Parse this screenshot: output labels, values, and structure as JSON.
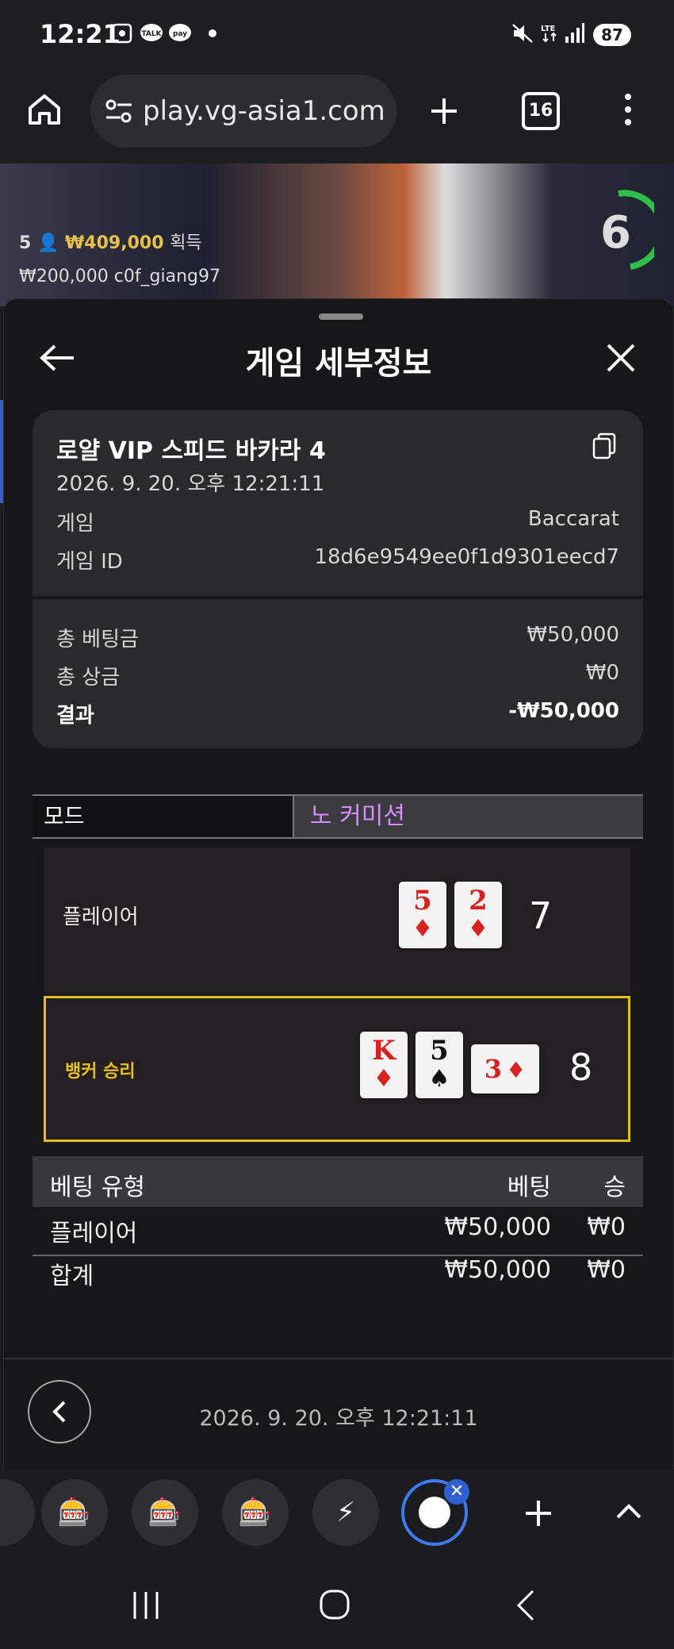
{
  "status_bar": {
    "time": "12:21",
    "battery": "87"
  },
  "browser": {
    "url": "play.vg-asia1.com",
    "tab_count": "16"
  },
  "video": {
    "players": "5",
    "won_amount": "₩409,000",
    "won_label": "획득",
    "bet_line": "₩200,000  c0f_giang97",
    "timer": "6"
  },
  "sheet": {
    "title": "게임 세부정보",
    "game_name": "로얄 VIP 스피드 바카라 4",
    "datetime": "2026. 9. 20. 오후 12:21:11",
    "game_label": "게임",
    "game_value": "Baccarat",
    "game_id_label": "게임 ID",
    "game_id_value": "18d6e9549ee0f1d9301eecd7",
    "total_bet_label": "총 베팅금",
    "total_bet_value": "₩50,000",
    "total_prize_label": "총 상금",
    "total_prize_value": "₩0",
    "result_label": "결과",
    "result_value": "-₩50,000",
    "mode_label": "모드",
    "mode_value": "노 커미션",
    "player": {
      "label": "플레이어",
      "score": "7",
      "cards": [
        {
          "rank": "5",
          "suit": "♦"
        },
        {
          "rank": "2",
          "suit": "♦"
        }
      ]
    },
    "banker": {
      "label": "뱅커 승리",
      "score": "8",
      "cards": [
        {
          "rank": "K",
          "suit": "♦"
        },
        {
          "rank": "5",
          "suit": "♠"
        },
        {
          "rank": "3",
          "suit": "♦"
        }
      ]
    },
    "bet_table": {
      "headers": [
        "베팅 유형",
        "베팅",
        "승"
      ],
      "rows": [
        [
          "플레이어",
          "₩50,000",
          "₩0"
        ]
      ],
      "total": [
        "합계",
        "₩50,000",
        "₩0"
      ]
    },
    "footer_datetime": "2026. 9. 20. 오후 12:21:11"
  },
  "colors": {
    "accent_gold": "#e8c04a",
    "mode_value": "#d98cff",
    "banker_border": "#e0c020",
    "red_suit": "#d6231f"
  }
}
